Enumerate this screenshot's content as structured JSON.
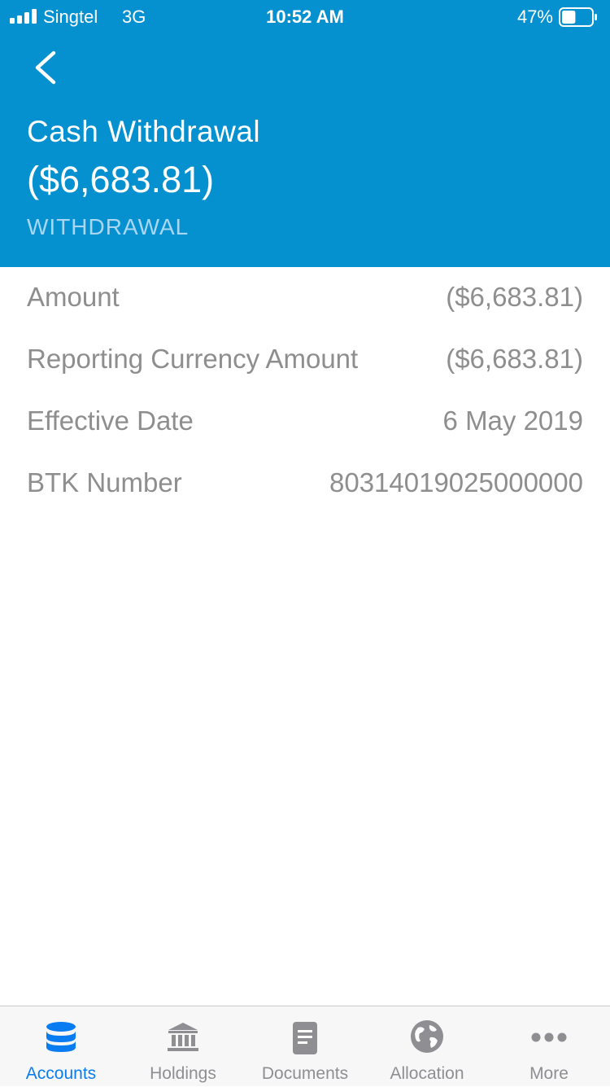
{
  "status_bar": {
    "carrier": "Singtel",
    "network": "3G",
    "time": "10:52 AM",
    "battery_percent": "47%",
    "battery_level": 0.47
  },
  "header": {
    "back_icon": "chevron-left-icon",
    "title": "Cash Withdrawal",
    "amount": "($6,683.81)",
    "type": "WITHDRAWAL"
  },
  "details": [
    {
      "label": "Amount",
      "value": "($6,683.81)"
    },
    {
      "label": "Reporting Currency Amount",
      "value": "($6,683.81)"
    },
    {
      "label": "Effective Date",
      "value": "6 May 2019"
    },
    {
      "label": "BTK Number",
      "value": "80314019025000000"
    }
  ],
  "tabbar": {
    "active": "accounts",
    "tabs": [
      {
        "id": "accounts",
        "label": "Accounts",
        "icon": "database-icon"
      },
      {
        "id": "holdings",
        "label": "Holdings",
        "icon": "bank-icon"
      },
      {
        "id": "documents",
        "label": "Documents",
        "icon": "document-icon"
      },
      {
        "id": "allocation",
        "label": "Allocation",
        "icon": "globe-icon"
      },
      {
        "id": "more",
        "label": "More",
        "icon": "ellipsis-icon"
      }
    ]
  },
  "colors": {
    "header_bg": "#0590cf",
    "header_subtle_text": "#a9d6f0",
    "detail_text": "#8e8e8e",
    "tab_active": "#0a7cf2",
    "tab_inactive": "#8e8e93"
  }
}
